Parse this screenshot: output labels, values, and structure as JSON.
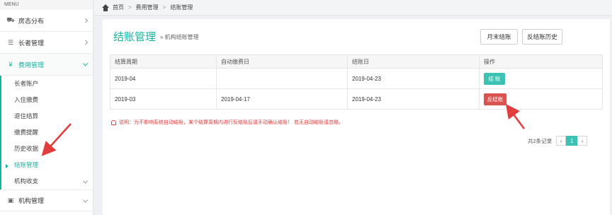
{
  "sidebar": {
    "menu_label": "MENU",
    "groups": [
      {
        "label": "房态分布",
        "icon": "car-icon"
      },
      {
        "label": "长者管理",
        "icon": "list-icon"
      },
      {
        "label": "费用管理",
        "icon": "yen-icon",
        "open": true
      },
      {
        "label": "机构管理",
        "icon": "building-icon"
      }
    ],
    "sub_items": [
      "长者账户",
      "入住缴费",
      "退住结算",
      "缴费提醒",
      "历史收据",
      "结账管理",
      "机构收支"
    ],
    "active_sub": "结账管理"
  },
  "breadcrumb": {
    "home": "首页",
    "level1": "费用管理",
    "level2": "结账管理"
  },
  "panel": {
    "title": "结账管理",
    "subtitle": "» 机构结账管理",
    "btn_month_end": "月末结账",
    "btn_reverse_history": "反结账历史"
  },
  "table": {
    "headers": [
      "结算周期",
      "自动缴费日",
      "结账日",
      "操作"
    ],
    "rows": [
      {
        "period": "2019-04",
        "auto_date": "",
        "settle_date": "2019-04-23",
        "action": "结 账"
      },
      {
        "period": "2019-03",
        "auto_date": "2019-04-17",
        "settle_date": "2019-04-23",
        "action": "反结账"
      }
    ]
  },
  "notice": "说明：为不影响系统自动结账，某个结算周期内进行反结账后请手动确认结账！ 若无自动结账请忽略。",
  "pagination": {
    "total": "共2条记录",
    "prev": "‹",
    "current": "1",
    "next": "›"
  },
  "colors": {
    "accent": "#17b3a3",
    "button_teal": "#3cc2b3",
    "danger": "#d9534f",
    "annotation": "#e23c3c"
  }
}
